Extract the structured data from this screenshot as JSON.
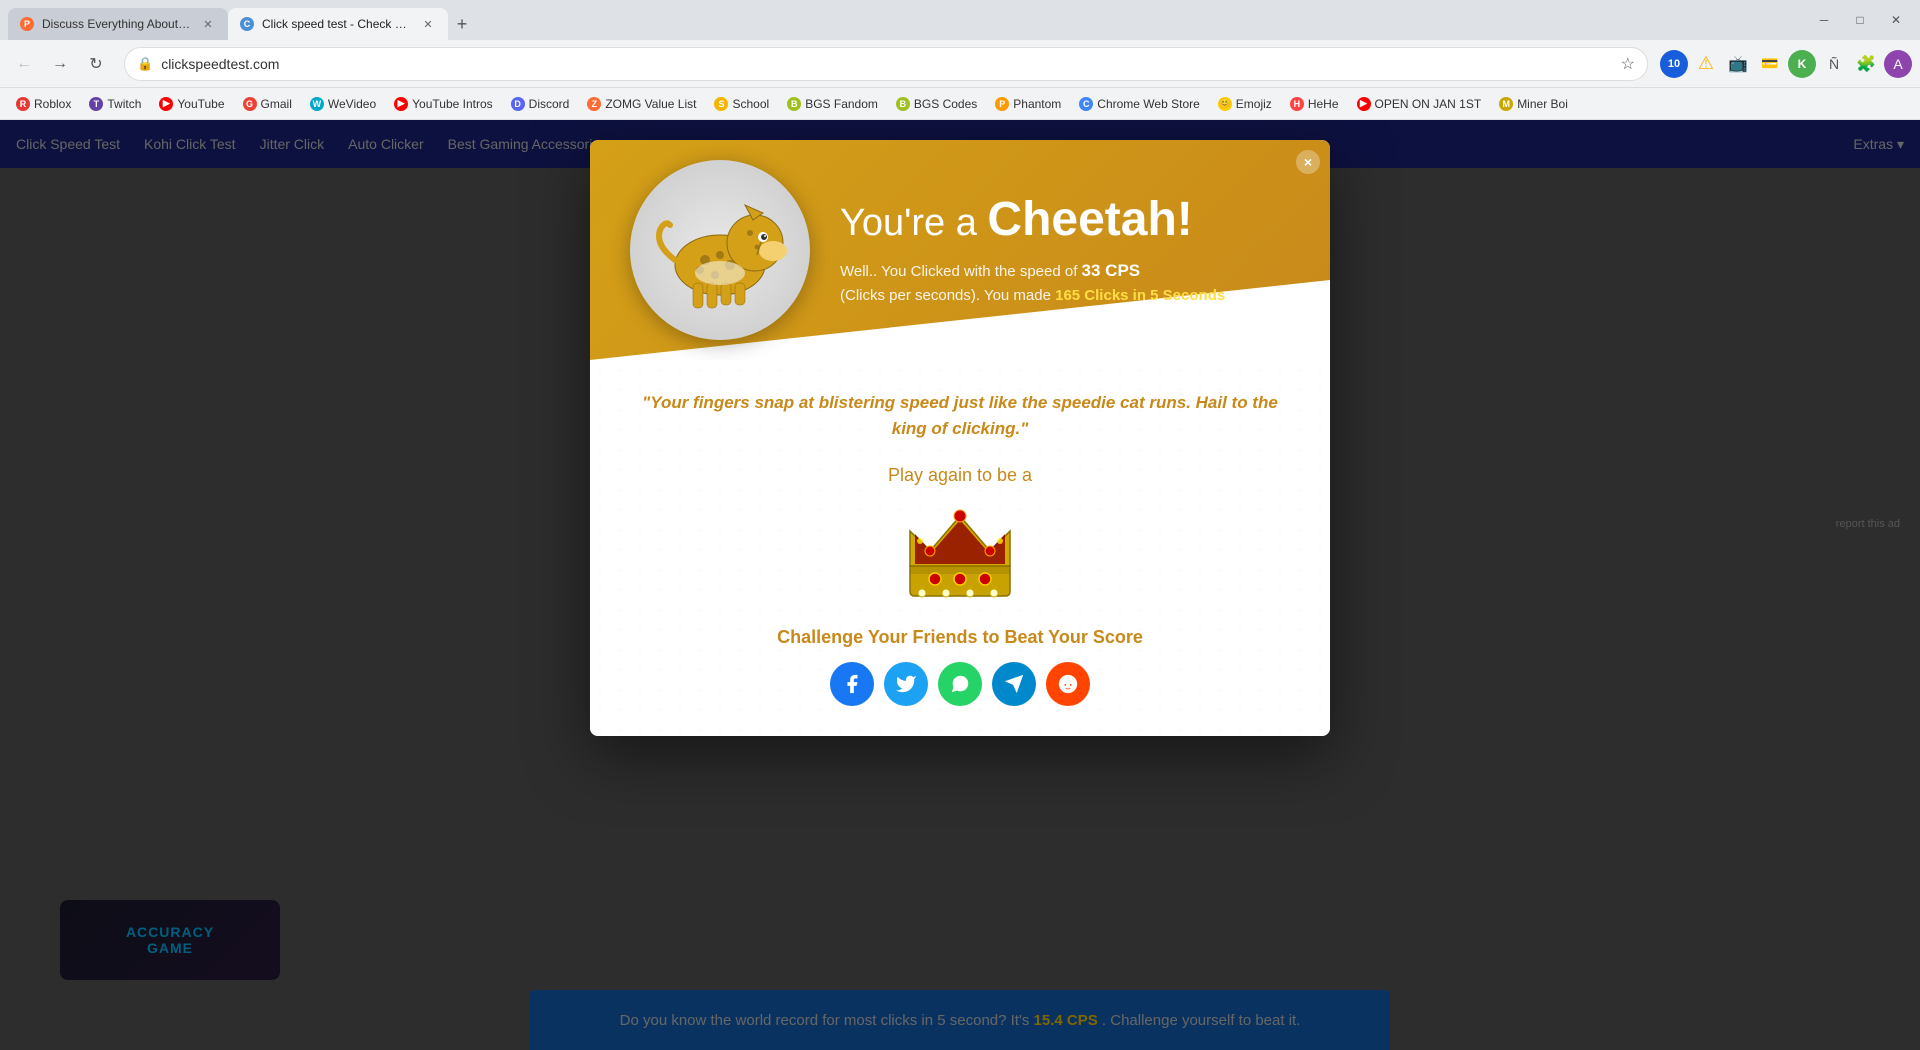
{
  "browser": {
    "tabs": [
      {
        "id": "tab1",
        "title": "Discuss Everything About Phanto...",
        "favicon_color": "#ff6b35",
        "favicon_letter": "P",
        "active": false
      },
      {
        "id": "tab2",
        "title": "Click speed test - Check Clicks pe...",
        "favicon_color": "#4a90d9",
        "favicon_letter": "C",
        "active": true
      }
    ],
    "address": "clickspeedtest.com",
    "address_full": "https://clickspeedtest.com"
  },
  "bookmarks": [
    {
      "id": "roblox",
      "label": "Roblox",
      "color": "#e53935"
    },
    {
      "id": "twitch",
      "label": "Twitch",
      "color": "#6441a5"
    },
    {
      "id": "youtube",
      "label": "YouTube",
      "color": "#ff0000"
    },
    {
      "id": "gmail",
      "label": "Gmail",
      "color": "#ea4335"
    },
    {
      "id": "wevideo",
      "label": "WeVideo",
      "color": "#00a8cc"
    },
    {
      "id": "ytintros",
      "label": "YouTube Intros",
      "color": "#ff0000"
    },
    {
      "id": "discord",
      "label": "Discord",
      "color": "#5865f2"
    },
    {
      "id": "zomg",
      "label": "ZOMG Value List",
      "color": "#ff6b35"
    },
    {
      "id": "school",
      "label": "School",
      "color": "#f4b400"
    },
    {
      "id": "bgsfandom",
      "label": "BGS Fandom",
      "color": "#a0c020"
    },
    {
      "id": "bgscodes",
      "label": "BGS Codes",
      "color": "#a0c020"
    },
    {
      "id": "phantom",
      "label": "Phantom",
      "color": "#ff9900"
    },
    {
      "id": "chromeweb",
      "label": "Chrome Web Store",
      "color": "#4285f4"
    },
    {
      "id": "emojiz",
      "label": "Emojiz",
      "color": "#ffcc00"
    },
    {
      "id": "hehe",
      "label": "HeHe",
      "color": "#ff4444"
    },
    {
      "id": "open",
      "label": "OPEN ON JAN 1ST",
      "color": "#ff0000"
    },
    {
      "id": "minerboi",
      "label": "Miner Boi",
      "color": "#c8a800"
    }
  ],
  "site_nav": {
    "links": [
      {
        "id": "click-speed",
        "label": "Click Speed Test"
      },
      {
        "id": "kohi",
        "label": "Kohi Click Test"
      },
      {
        "id": "jitter",
        "label": "Jitter Click"
      },
      {
        "id": "auto",
        "label": "Auto Clicker"
      },
      {
        "id": "best-gaming",
        "label": "Best Gaming Accessories"
      }
    ],
    "extras_label": "Extras ▾"
  },
  "modal": {
    "close_btn": "×",
    "heading_prefix": "You're a ",
    "heading_animal": "Cheetah!",
    "subtitle_intro": "Well.. You Clicked with the speed of ",
    "cps_value": "33 CPS",
    "subtitle_mid": " (Clicks per seconds). You made ",
    "clicks_value": "165 Clicks in 5 Seconds",
    "quote": "\"Your fingers snap at blistering speed just like the speedie cat runs. Hail to the king of clicking.\"",
    "play_again_label": "Play again to be a",
    "challenge_label": "Challenge Your Friends to Beat Your Score",
    "social_buttons": [
      {
        "id": "facebook",
        "label": "f",
        "title": "Share on Facebook"
      },
      {
        "id": "twitter",
        "label": "t",
        "title": "Share on Twitter"
      },
      {
        "id": "whatsapp",
        "label": "w",
        "title": "Share on WhatsApp"
      },
      {
        "id": "telegram",
        "label": "✈",
        "title": "Share on Telegram"
      },
      {
        "id": "reddit",
        "label": "r",
        "title": "Share on Reddit"
      }
    ]
  },
  "page": {
    "accuracy_label": "ACCURACY\nGAME",
    "world_record_text": "Do you know the world record for most clicks in 5 second? It's ",
    "world_record_cps": "15.4 CPS",
    "world_record_suffix": ". Challenge yourself to beat it."
  },
  "report_ad": "report this ad"
}
